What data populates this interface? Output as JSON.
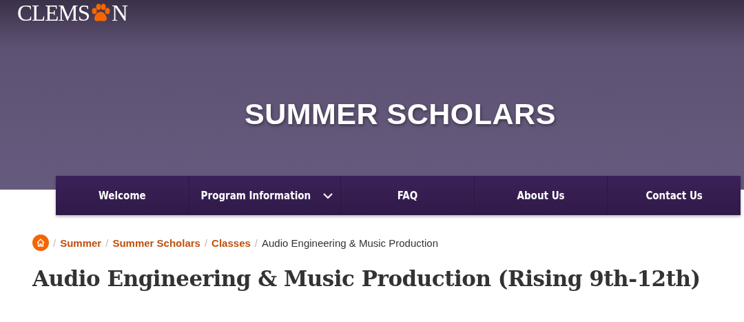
{
  "logo": {
    "text_before": "CLEMS",
    "text_after": "N"
  },
  "hero": {
    "title": "SUMMER SCHOLARS"
  },
  "nav": [
    {
      "label": "Welcome",
      "has_dropdown": false
    },
    {
      "label": "Program Information",
      "has_dropdown": true
    },
    {
      "label": "FAQ",
      "has_dropdown": false
    },
    {
      "label": "About Us",
      "has_dropdown": false
    },
    {
      "label": "Contact Us",
      "has_dropdown": false
    }
  ],
  "breadcrumb": [
    {
      "separator": "/",
      "label": "Summer",
      "kind": "link"
    },
    {
      "separator": "/",
      "label": "Summer Scholars",
      "kind": "link"
    },
    {
      "separator": "/",
      "label": "Classes",
      "kind": "link"
    },
    {
      "separator": "/",
      "label": "Audio Engineering & Music Production",
      "kind": "current"
    }
  ],
  "page_title": "Audio Engineering & Music Production (Rising 9th-12th)"
}
